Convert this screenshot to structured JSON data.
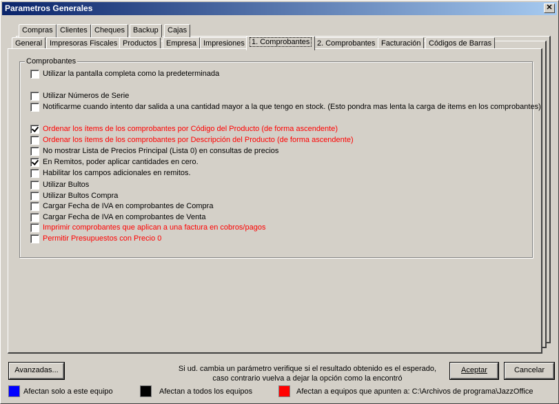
{
  "window": {
    "title": "Parametros Generales"
  },
  "tabs_row1": [
    "Compras",
    "Clientes",
    "Cheques",
    "Backup",
    "Cajas"
  ],
  "tabs_row2": [
    "General",
    "Impresoras Fiscales",
    "Productos",
    "Empresa",
    "Impresiones",
    "1. Comprobantes",
    "2. Comprobantes",
    "Facturación",
    "Códigos de Barras"
  ],
  "group": {
    "title": "Comprobantes",
    "options": [
      {
        "label": "Utilizar la pantalla completa como la predeterminada",
        "checked": false,
        "red": false
      },
      {
        "label": "Utilizar Números de Serie",
        "checked": false,
        "red": false
      },
      {
        "label": "Notificarme cuando intento dar salida a una cantidad mayor a la que tengo en stock. (Esto pondra mas lenta la carga de items en los comprobantes)",
        "checked": false,
        "red": false
      },
      {
        "label": "Ordenar los ítems de los comprobantes por Código del Producto (de forma ascendente)",
        "checked": true,
        "red": true
      },
      {
        "label": "Ordenar los ítems de los comprobantes por Descripción del Producto (de forma ascendente)",
        "checked": false,
        "red": true
      },
      {
        "label": "No mostrar Lista de Precios Principal (Lista 0) en consultas de precios",
        "checked": false,
        "red": false
      },
      {
        "label": "En Remitos, poder aplicar cantidades en cero.",
        "checked": true,
        "red": false
      },
      {
        "label": "Habilitar los campos adicionales en remitos.",
        "checked": false,
        "red": false
      },
      {
        "label": "Utilizar Bultos",
        "checked": false,
        "red": false
      },
      {
        "label": "Utilizar Bultos Compra",
        "checked": false,
        "red": false
      },
      {
        "label": "Cargar Fecha de IVA en comprobantes de Compra",
        "checked": false,
        "red": false
      },
      {
        "label": "Cargar Fecha de IVA en comprobantes de Venta",
        "checked": false,
        "red": false
      },
      {
        "label": "Imprimir comprobantes que aplican a una factura en cobros/pagos",
        "checked": false,
        "red": true
      },
      {
        "label": "Permitir Presupuestos con Precio 0",
        "checked": false,
        "red": true
      }
    ]
  },
  "footer": {
    "advanced_button": "Avanzadas...",
    "notice_line1": "Si ud. cambia un parámetro verifique si el resultado obtenido es el esperado,",
    "notice_line2": "caso contrario vuelva a dejar la opción como la encontró",
    "accept_button": "Aceptar",
    "cancel_button": "Cancelar"
  },
  "legend": {
    "blue": {
      "color": "#0000ff",
      "label": "Afectan solo a este equipo"
    },
    "black": {
      "color": "#000000",
      "label": "Afectan a todos los equipos"
    },
    "red": {
      "color": "#ff0000",
      "label": "Afectan a equipos que apunten a: C:\\Archivos de programa\\JazzOffice"
    }
  }
}
